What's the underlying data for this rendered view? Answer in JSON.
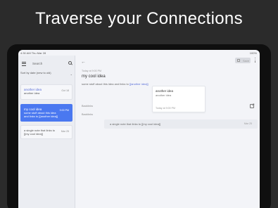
{
  "headline": "Traverse your Connections",
  "status": {
    "time": "4:30 AM",
    "date": "Thu Mar 28",
    "battery": "100%"
  },
  "sidebar": {
    "search_label": "Search",
    "sort_label": "Sort by date (new to old)",
    "notes": [
      {
        "title": "another idea",
        "subtitle": "another idea",
        "date": "Oct 18"
      },
      {
        "title": "my cool idea",
        "subtitle": "some stuff about this idea and links to [[another idea]]",
        "date": "9:00 PM"
      },
      {
        "title": "",
        "subtitle": "a single note that links to [[my cool idea]]",
        "date": "Mar 25"
      }
    ]
  },
  "main": {
    "save_label": "Save",
    "note_date": "Today at 9:00 PM",
    "note_title": "my cool idea",
    "note_body_prefix": "some stuff about this idea and links to ",
    "note_body_link": "[[another idea]]",
    "preview": {
      "title": "another idea",
      "subtitle": "another idea",
      "date": "Today at 9:00 PM"
    },
    "backlinks_label_1": "Backlinks",
    "backlinks_label_2": "Backlinks",
    "backlink": {
      "text": "a single note that links to [[my cool idea]]",
      "date": "Mar 25"
    }
  },
  "colors": {
    "accent": "#4a78f0",
    "link": "#5a6fd8",
    "background": "#2b2b2b"
  }
}
